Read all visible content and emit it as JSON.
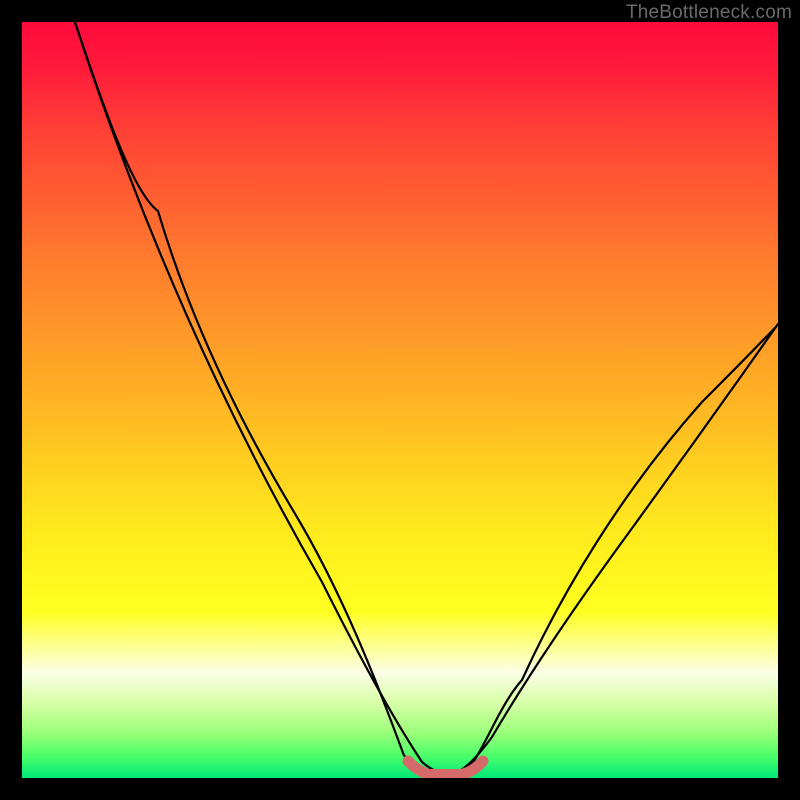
{
  "watermark": "TheBottleneck.com",
  "chart_data": {
    "type": "line",
    "title": "",
    "xlabel": "",
    "ylabel": "",
    "xlim": [
      0,
      100
    ],
    "ylim": [
      0,
      100
    ],
    "series": [
      {
        "name": "bottleneck-black-curve",
        "x": [
          7,
          12,
          18,
          24,
          30,
          36,
          42,
          47,
          50.5,
          53,
          55,
          57,
          59,
          61,
          63,
          66,
          72,
          80,
          90,
          100
        ],
        "y": [
          100,
          88,
          75,
          62,
          49,
          36,
          23,
          11,
          3,
          0.7,
          0.4,
          0.4,
          0.7,
          2,
          6,
          13,
          25,
          38,
          50,
          60
        ]
      },
      {
        "name": "bottleneck-flat-red-segment",
        "x": [
          51,
          52.5,
          54,
          56,
          58,
          59.5,
          61
        ],
        "y": [
          2.3,
          0.9,
          0.5,
          0.4,
          0.5,
          0.9,
          2.3
        ]
      }
    ],
    "gradient_stops": [
      {
        "pos": 0,
        "color": "#ff0a3c"
      },
      {
        "pos": 6,
        "color": "#ff1a3a"
      },
      {
        "pos": 14,
        "color": "#ff3f36"
      },
      {
        "pos": 22,
        "color": "#ff5a32"
      },
      {
        "pos": 30,
        "color": "#ff772e"
      },
      {
        "pos": 38,
        "color": "#ff8f2a"
      },
      {
        "pos": 46,
        "color": "#ffa726"
      },
      {
        "pos": 54,
        "color": "#ffc022"
      },
      {
        "pos": 60,
        "color": "#ffd41f"
      },
      {
        "pos": 66,
        "color": "#ffe61e"
      },
      {
        "pos": 72,
        "color": "#fff41e"
      },
      {
        "pos": 78,
        "color": "#ffff22"
      },
      {
        "pos": 86,
        "color": "#fbffe6"
      },
      {
        "pos": 90,
        "color": "#d8ffa8"
      },
      {
        "pos": 94,
        "color": "#9cff7a"
      },
      {
        "pos": 97,
        "color": "#4cff6a"
      },
      {
        "pos": 100,
        "color": "#00e878"
      }
    ],
    "colors": {
      "curve": "#000000",
      "flat_segment": "#d46a6a",
      "frame": "#000000"
    }
  }
}
